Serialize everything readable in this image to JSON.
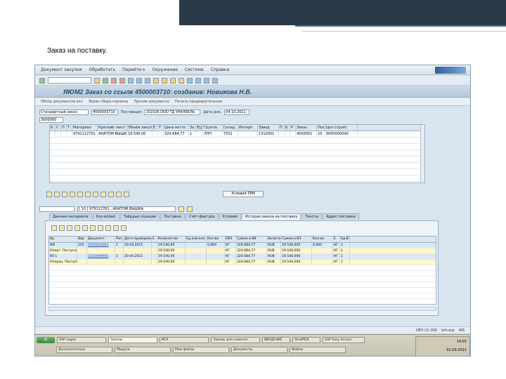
{
  "slide": {
    "title": "Заказ на поставку."
  },
  "menu": [
    "Документ закупки",
    "Обработать",
    "Перейти к",
    "Окружение",
    "Система",
    "Справка"
  ],
  "window_title": "ЯЮМ2 Заказ со ссылк 4500003710: создание: Новикова Н.В.",
  "app_toolbar": [
    "Обзор документов вкл",
    "Экран сбора корзины",
    "Прочие документы",
    "Печать предварительная"
  ],
  "header": {
    "doc_type": "Стандартный заказ",
    "doc_number": "4500003710",
    "supplier_label": "Поставщик",
    "supplier_value": "102326 ООО ТД УРАЛБЕЛЬ",
    "date_label": "Дата док.",
    "date_value": "04.10.2011",
    "extra": "3000000"
  },
  "items_grid": {
    "columns": [
      "Б",
      "С",
      "П",
      "Т",
      "Материал",
      "Краткий текст",
      "Объём закупки",
      "Е",
      "Т",
      "Цена нетто",
      "За",
      "ЕЦ",
      "Группа",
      "Склад",
      "Интерп.",
      "Завод",
      "П",
      "Б",
      "Р",
      "Заказ",
      "Поз.",
      "Цел.строит."
    ],
    "row": [
      "",
      "",
      "",
      "",
      "9791112701",
      "АНАТОМ ВЫШКА",
      "19.540,00",
      "",
      "",
      "324.684,77",
      "1",
      "",
      "ЛЭП",
      "7501",
      "",
      "1310001",
      "",
      "",
      "",
      "4000001",
      "10",
      "9000000040"
    ]
  },
  "cond_button": "Условия ТЕМ",
  "position_field": "[ 10 ] 979112701 , АНАТОМ ВЫШКА",
  "tabs": [
    "Данные материала",
    "Кол-во/вес",
    "Твёрдые позиции",
    "Поставка",
    "Счёт-фактура",
    "Условия",
    "История заказа на поставку",
    "Тексты",
    "Адрес поставки"
  ],
  "active_tab": 6,
  "history_table": {
    "columns": [
      "Кр.",
      "Вдк",
      "Документ",
      "Поз.",
      "Дата проведения",
      "Е",
      "Количество",
      "Ед.изм.кол.",
      "Кол-во",
      "ЕИЗ",
      "Сумма в ВВ",
      "Валюта",
      "Сумма в ВЗ",
      "Кол-во",
      "Е",
      "Ед.ВЗ"
    ],
    "rows": [
      {
        "cls": "blue",
        "cells": [
          "WE",
          "101",
          "5000093063",
          "1",
          "20.04.2011",
          "",
          "19.540,00",
          "",
          "0,000",
          "КГ",
          "324.684,77",
          "RUB",
          "19.540,000",
          "0,000",
          "КГ",
          "1"
        ]
      },
      {
        "cls": "hl",
        "cells": [
          "Оперт. Поступления:",
          "",
          "",
          "",
          "",
          "",
          "19.540,00",
          "",
          "",
          "КГ",
          "324.684,77",
          "RUB",
          "19.540,000",
          "",
          "КГ",
          "1"
        ]
      },
      {
        "cls": "blue",
        "cells": [
          "RE-L",
          "",
          "5100099966",
          "1",
          "20.04.2011",
          "",
          "19.540,00",
          "",
          "",
          "КГ",
          "324.684,77",
          "RUB",
          "19.540,000",
          "",
          "КГ",
          "1"
        ]
      },
      {
        "cls": "hl",
        "cells": [
          "Операц. Поступление",
          "",
          "",
          "",
          "",
          "",
          "19.540,00",
          "",
          "",
          "КГ",
          "324.684,77",
          "RUB",
          "19.540,000",
          "",
          "КГ",
          "1"
        ]
      }
    ]
  },
  "status": [
    "DEV (1) 000",
    "brh-erp",
    "INS"
  ],
  "taskbar": {
    "row1": [
      "SAP Logon",
      "Заказы",
      "ИСР",
      "Заказы для клиента",
      "ВВЕДЕНИЕ",
      "ShellPDX",
      "SAP Easy Access"
    ],
    "row2": [
      "Дополнительно",
      "Модули",
      "Мои файлы",
      "Документы",
      "Файлы"
    ],
    "time": "14:55",
    "date": "01.09.2011"
  }
}
